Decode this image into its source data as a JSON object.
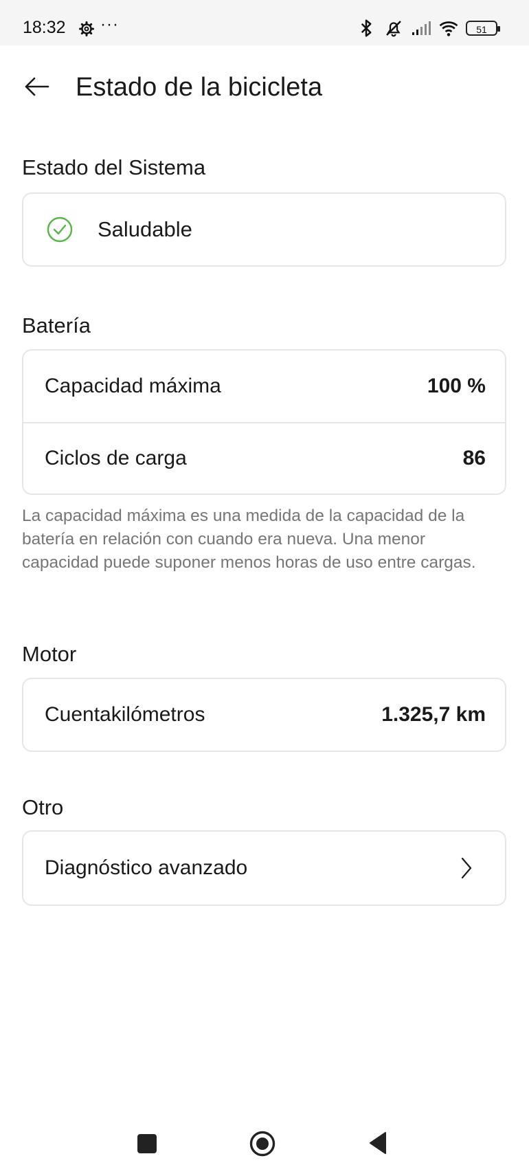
{
  "status_bar": {
    "time": "18:32",
    "dots": "···",
    "battery": "51",
    "icons": [
      "gear-icon",
      "bluetooth-icon",
      "mute-icon",
      "signal-icon",
      "wifi-icon",
      "battery-icon"
    ]
  },
  "header": {
    "title": "Estado de la bicicleta",
    "back_icon": "back-arrow-icon"
  },
  "system": {
    "heading": "Estado del Sistema",
    "status": "Saludable",
    "status_icon": "check-circle-icon",
    "status_color": "#57b447"
  },
  "battery": {
    "heading": "Batería",
    "rows": [
      {
        "label": "Capacidad máxima",
        "value": "100 %"
      },
      {
        "label": "Ciclos de carga",
        "value": "86"
      }
    ],
    "note": "La capacidad máxima es una medida de la capacidad de la batería en relación con cuando era nueva. Una menor capacidad puede suponer menos horas de uso entre cargas."
  },
  "motor": {
    "heading": "Motor",
    "rows": [
      {
        "label": "Cuentakilómetros",
        "value": "1.325,7 km"
      }
    ]
  },
  "other": {
    "heading": "Otro",
    "item_label": "Diagnóstico avanzado",
    "item_icon": "chevron-right-icon"
  },
  "nav": {
    "icons": [
      "recents-icon",
      "home-icon",
      "back-icon"
    ]
  }
}
